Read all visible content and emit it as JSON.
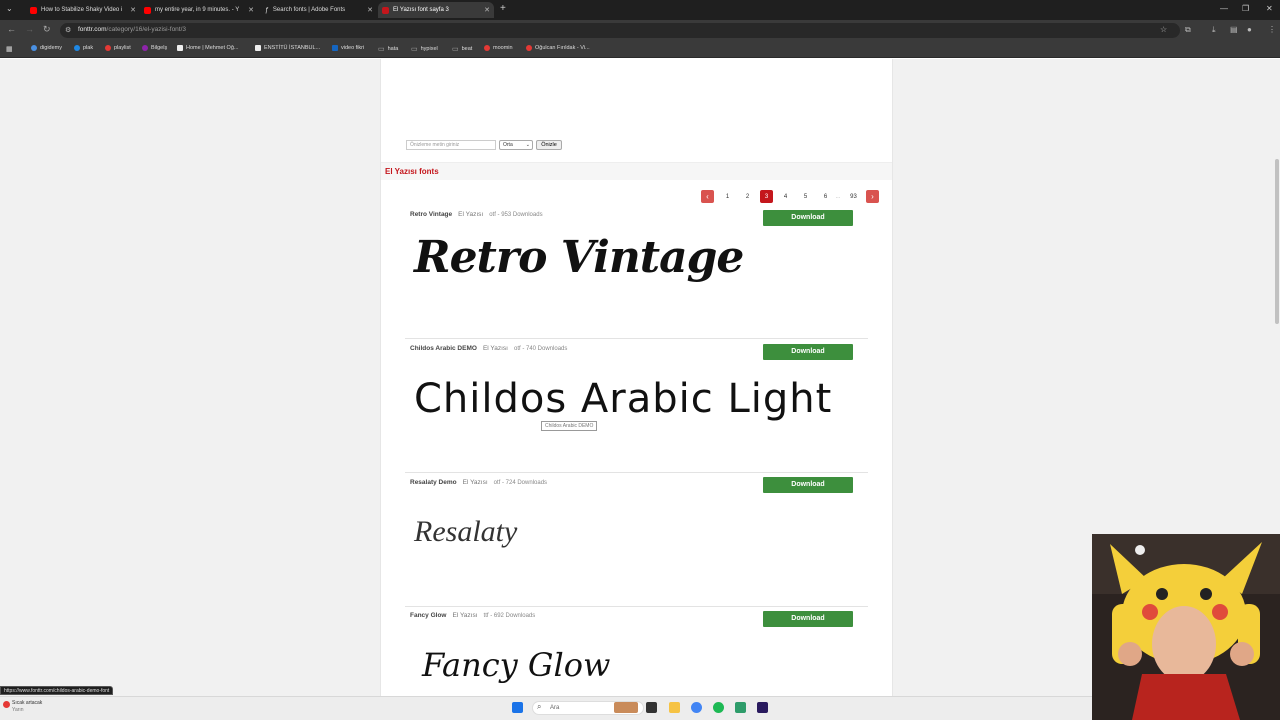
{
  "browser": {
    "tabs": [
      {
        "title": "How to Stabilize Shaky Video i",
        "favicon_color": "#ff0000",
        "active": false
      },
      {
        "title": "my entire year, in 9 minutes. - Y",
        "favicon_color": "#ff0000",
        "active": false
      },
      {
        "title": "Search fonts | Adobe Fonts",
        "favicon_color": "#e8e8e8",
        "active": false
      },
      {
        "title": "El Yazısı font sayfa 3",
        "favicon_color": "#c4161c",
        "active": true
      }
    ],
    "new_tab_icon": "plus-icon",
    "url_host": "fonttr.com",
    "url_path": "/category/16/el-yazisi-font/3",
    "bookmarks": [
      {
        "label": "digidemy",
        "icon_color": "#4a90e2"
      },
      {
        "label": "plak",
        "icon_color": "#1e88e5"
      },
      {
        "label": "playlist",
        "icon_color": "#e53935"
      },
      {
        "label": "Bilgelş",
        "icon_color": "#8e24aa"
      },
      {
        "label": "Home | Mehmet Oğ...",
        "icon_color": "#eeeeee"
      },
      {
        "label": "ENSTİTÜ İSTANBUL...",
        "icon_color": "#eeeeee"
      },
      {
        "label": "video fikri",
        "icon_color": "#1565c0"
      },
      {
        "label": "hata",
        "icon_color": "#aaaaaa"
      },
      {
        "label": "hypixel",
        "icon_color": "#aaaaaa"
      },
      {
        "label": "beat",
        "icon_color": "#aaaaaa"
      },
      {
        "label": "moomin",
        "icon_color": "#e53935"
      },
      {
        "label": "Oğulcan Fırıldak - Vi...",
        "icon_color": "#e53935"
      }
    ],
    "status_url": "https://www.fonttr.com/childos-arabic-demo-font"
  },
  "preview": {
    "placeholder": "Önizleme metin giriniz",
    "size_selected": "Orta",
    "button_label": "Önizle"
  },
  "section_title": "El Yazısı fonts",
  "pagination": {
    "prev_label": "‹",
    "next_label": "›",
    "pages": [
      "1",
      "2",
      "3",
      "4",
      "5",
      "6"
    ],
    "current": "3",
    "ellipsis": "...",
    "last": "93"
  },
  "fonts": [
    {
      "name": "Retro Vintage",
      "category": "El Yazısı",
      "meta": "otf - 953 Downloads",
      "download_label": "Download",
      "sample": "Retro Vintage"
    },
    {
      "name": "Childos Arabic DEMO",
      "category": "El Yazısı",
      "meta": "otf - 740 Downloads",
      "download_label": "Download",
      "sample": "Childos Arabic Light"
    },
    {
      "name": "Resalaty Demo",
      "category": "El Yazısı",
      "meta": "otf - 724 Downloads",
      "download_label": "Download",
      "sample": "Resalaty"
    },
    {
      "name": "Fancy Glow",
      "category": "El Yazısı",
      "meta": "ttf - 692 Downloads",
      "download_label": "Download",
      "sample": "Fancy Glow"
    }
  ],
  "tooltip": "Childos Arabic DEMO",
  "taskbar": {
    "weather_line1": "Sıcak artacak",
    "weather_line2": "Yarın",
    "search_placeholder": "Ara"
  }
}
